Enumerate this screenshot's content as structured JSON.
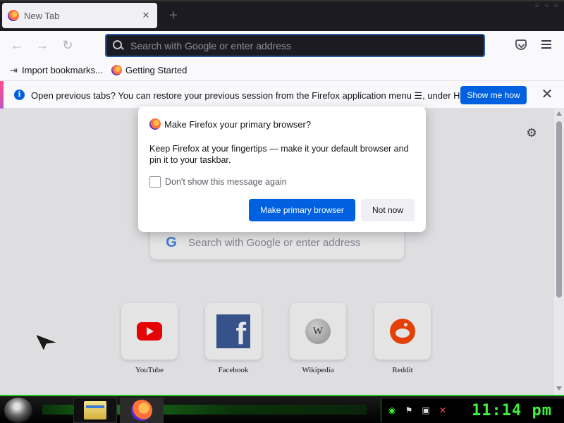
{
  "tab": {
    "title": "New Tab",
    "close_label": "✕",
    "new_tab_label": "+"
  },
  "navbar": {
    "back": "←",
    "forward": "→",
    "reload": "↻",
    "url_placeholder": "Search with Google or enter address"
  },
  "bookmarks": [
    {
      "label": "Import bookmarks...",
      "icon": "import-icon"
    },
    {
      "label": "Getting Started",
      "icon": "firefox-icon"
    }
  ],
  "notification": {
    "message": "Open previous tabs? You can restore your previous session from the Firefox application menu ☰, under History.",
    "button": "Show me how",
    "close": "✕",
    "info_glyph": "i"
  },
  "newtab_page": {
    "search_placeholder": "Search with Google or enter address",
    "search_logo": "G",
    "settings_glyph": "⚙",
    "top_sites": [
      {
        "label": "YouTube",
        "icon": "youtube-icon"
      },
      {
        "label": "Facebook",
        "icon": "facebook-icon"
      },
      {
        "label": "Wikipedia",
        "icon": "wikipedia-icon"
      },
      {
        "label": "Reddit",
        "icon": "reddit-icon"
      }
    ],
    "facebook_glyph": "f",
    "wikipedia_glyph": "W"
  },
  "dialog": {
    "title": "Make Firefox your primary browser?",
    "body": "Keep Firefox at your fingertips — make it your default browser and pin it to your taskbar.",
    "checkbox_label": "Don't show this message again",
    "checkbox_checked": false,
    "primary_button": "Make primary browser",
    "secondary_button": "Not now"
  },
  "taskbar": {
    "clock": "11:14 pm",
    "tray_icons": [
      "network-icon",
      "flag-icon",
      "power-icon",
      "volume-muted-icon"
    ],
    "accent_color": "#22c522"
  }
}
